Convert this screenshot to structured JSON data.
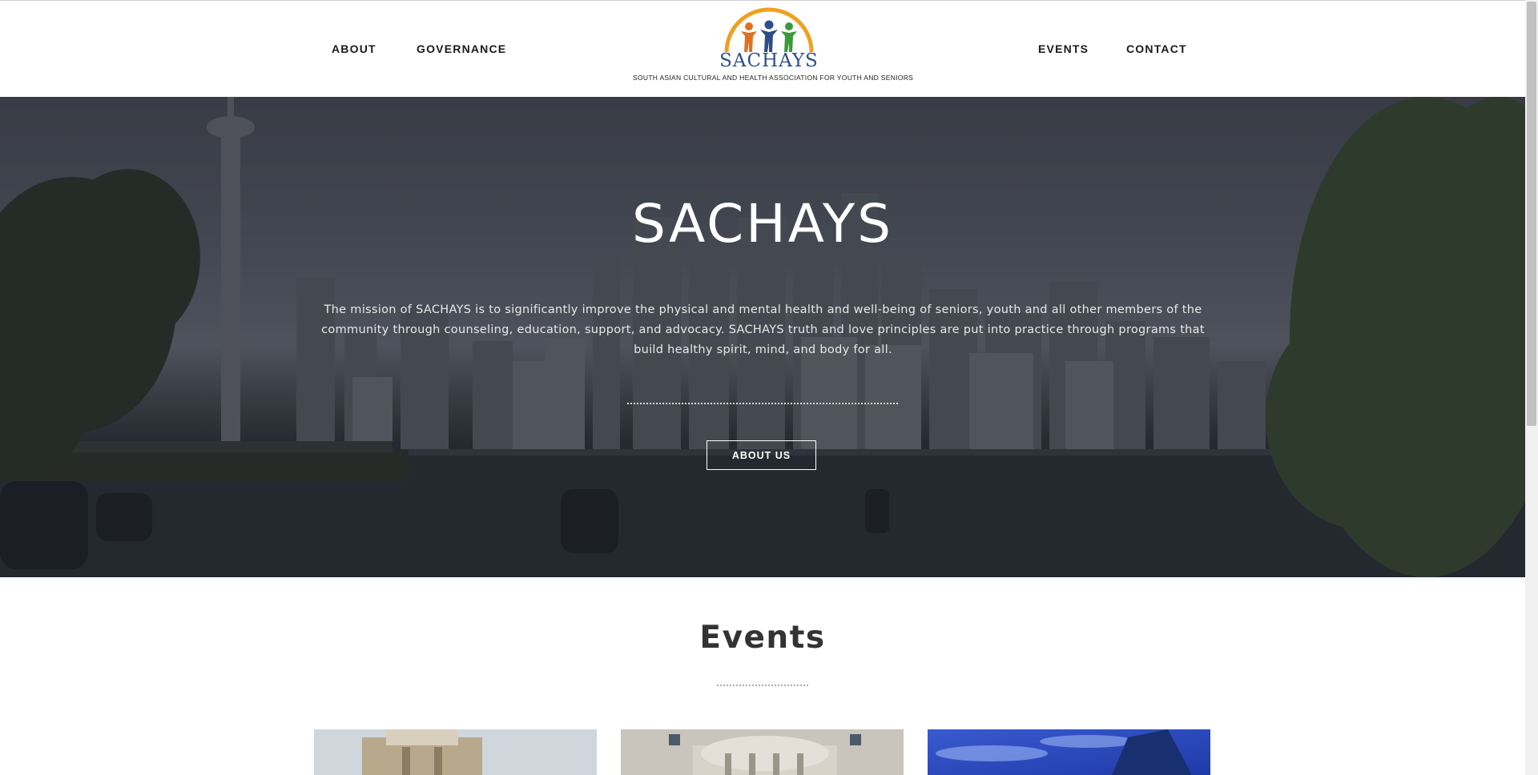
{
  "nav": {
    "left": [
      {
        "label": "ABOUT"
      },
      {
        "label": "GOVERNANCE"
      }
    ],
    "right": [
      {
        "label": "EVENTS"
      },
      {
        "label": "CONTACT"
      }
    ]
  },
  "logo": {
    "wordmark": "SACHAYS",
    "tagline": "SOUTH ASIAN CULTURAL AND HEALTH ASSOCIATION FOR YOUTH AND SENIORS"
  },
  "hero": {
    "title": "SACHAYS",
    "mission": "The mission of SACHAYS is to significantly improve the physical and mental health and well-being of seniors, youth and all other members of the community through counseling, education, support, and advocacy. SACHAYS truth and love principles are put into practice through programs that build healthy spirit, mind, and body for all.",
    "button_label": "ABOUT US"
  },
  "events": {
    "heading": "Events"
  },
  "colors": {
    "logo_arc": "#f0a020",
    "logo_blue": "#2d4e86",
    "logo_green": "#3a9a3a",
    "logo_orange": "#e07020"
  }
}
